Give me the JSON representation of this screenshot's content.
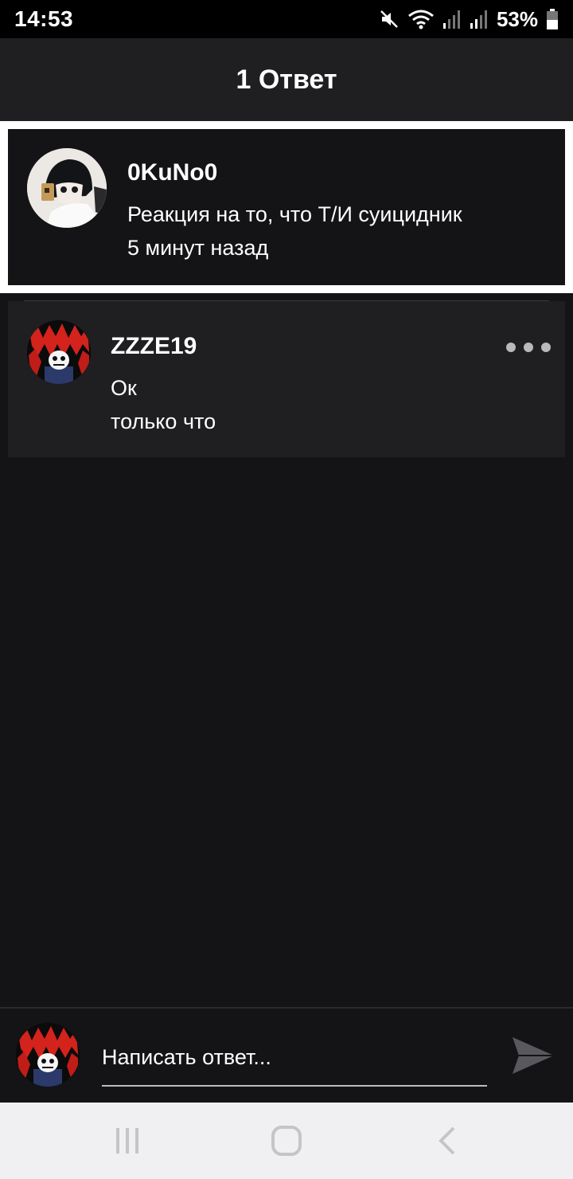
{
  "status": {
    "time": "14:53",
    "battery": "53%",
    "icons": [
      "mute-icon",
      "wifi-icon",
      "signal-icon",
      "signal-icon",
      "battery-icon"
    ]
  },
  "header": {
    "title": "1 Ответ"
  },
  "parent_comment": {
    "author": "0KuNo0",
    "text": "Реакция на то, что Т/И суицидник",
    "time": "5 минут назад"
  },
  "reply": {
    "author": "ZZZE19",
    "text": "Ок",
    "time": "только что",
    "more_icon": "more-dots-icon"
  },
  "composer": {
    "placeholder": "Написать ответ...",
    "send_icon": "send-icon"
  },
  "navbar": {
    "icons": [
      "recent-apps-icon",
      "home-icon",
      "back-icon"
    ]
  },
  "colors": {
    "background": "#141316",
    "card": "#1f1e21",
    "highlight_border": "#ffffff",
    "muted": "#b9b8bc"
  }
}
